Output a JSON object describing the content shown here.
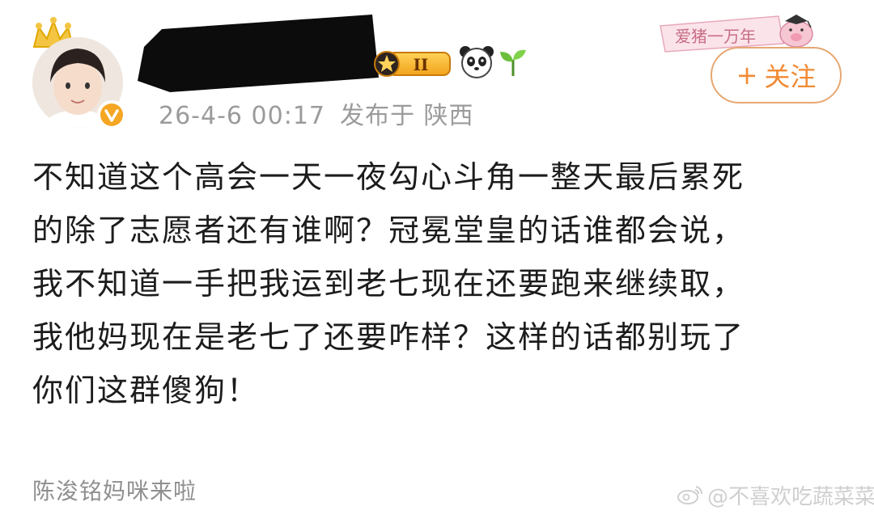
{
  "post": {
    "meta": {
      "time": "26-4-6 00:17",
      "source": "发布于 陕西"
    },
    "follow_label": "关注",
    "follow_plus": "+",
    "level_badge": "II",
    "body_lines": [
      "不知道这个高会一天一夜勾心斗角一整天最后累死",
      "的除了志愿者还有谁啊？冠冕堂皇的话谁都会说，",
      "我不知道一手把我运到老七现在还要跑来继续取，",
      "我他妈现在是老七了还要咋样？这样的话都别玩了",
      "你们这群傻狗！"
    ],
    "footer": "陈浚铭妈咪来啦",
    "decoration_text": "爱猪一万年",
    "watermark": "@不喜欢吃蔬菜菜",
    "colors": {
      "follow": "#f28a34",
      "meta": "#9b9b9b",
      "text": "#1c1c1c"
    },
    "icons": [
      "crown-icon",
      "verified-icon",
      "level-badge-icon",
      "panda-icon",
      "sprout-icon",
      "weibo-logo-icon"
    ]
  }
}
